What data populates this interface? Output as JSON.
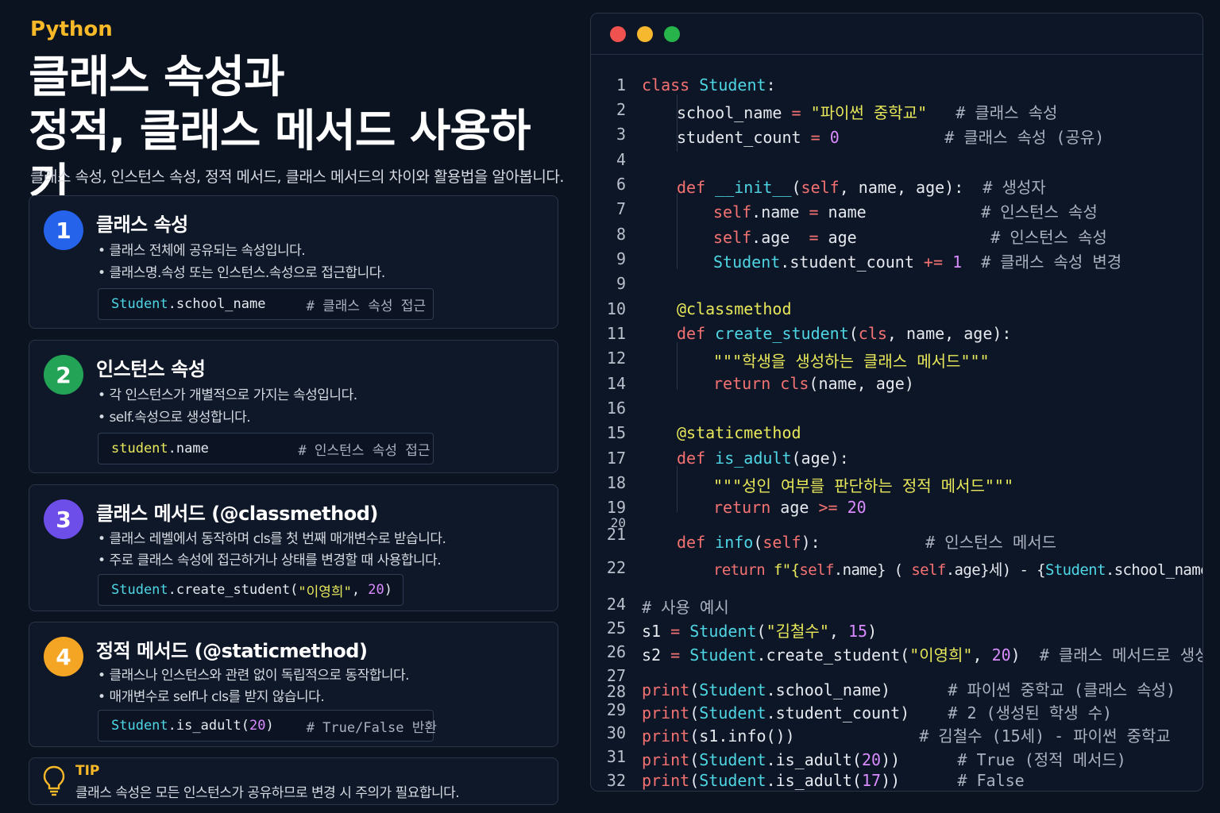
{
  "header": {
    "lang": "Python",
    "title_line1": "클래스 속성과",
    "title_line2": "정적, 클래스 메서드 사용하기",
    "subtitle": "클래스 속성, 인스턴스 속성, 정적 메서드, 클래스 메서드의 차이와 활용법을 알아봅니다."
  },
  "colors": {
    "badge1": "#2563eb",
    "badge2": "#22a355",
    "badge3": "#6d4ee8",
    "badge4": "#f5a524",
    "accent": "#f7b928"
  },
  "cards": [
    {
      "number": "1",
      "title": "클래스 속성",
      "bullets": [
        "클래스 전체에 공유되는 속성입니다.",
        "클래스명.속성 또는 인스턴스.속성으로 접근합니다."
      ],
      "code": {
        "obj": "Student",
        "rest": ".school_name",
        "comment": "# 클래스 속성 접근"
      }
    },
    {
      "number": "2",
      "title": "인스턴스 속성",
      "bullets": [
        "각 인스턴스가 개별적으로 가지는 속성입니다.",
        "self.속성으로 생성합니다."
      ],
      "code": {
        "obj": "student",
        "rest": ".name",
        "comment": "# 인스턴스 속성 접근"
      }
    },
    {
      "number": "3",
      "title": "클래스 메서드 (@classmethod)",
      "bullets": [
        "클래스 레벨에서 동작하며 cls를 첫 번째 매개변수로 받습니다.",
        "주로 클래스 속성에 접근하거나 상태를 변경할 때 사용합니다."
      ],
      "code": {
        "obj": "Student",
        "rest": ".create_student(",
        "str": "\"이영희\"",
        "sep": ", ",
        "num": "20",
        "end": ")"
      }
    },
    {
      "number": "4",
      "title": "정적 메서드 (@staticmethod)",
      "bullets": [
        "클래스나 인스턴스와 관련 없이 독립적으로 동작합니다.",
        "매개변수로 self나 cls를 받지 않습니다."
      ],
      "code": {
        "obj": "Student",
        "rest": ".is_adult(",
        "num": "20",
        "end": ")",
        "comment": "# True/False 반환"
      }
    }
  ],
  "tip": {
    "title": "TIP",
    "text": "클래스 속성은 모든 인스턴스가 공유하므로 변경 시 주의가 필요합니다.",
    "icon": "lightbulb-icon"
  },
  "editor": {
    "line_numbers": [
      "1",
      "2",
      "3",
      "4",
      "6",
      "7",
      "8",
      "9",
      "9",
      "10",
      "11",
      "12",
      "14",
      "16",
      "15",
      "17",
      "18",
      "19",
      "20",
      "21",
      "22",
      "24",
      "25",
      "26",
      "27",
      "28",
      "29",
      "30",
      "31",
      "32"
    ],
    "code": {
      "l1a": "class",
      "l1b": "Student",
      "l1c": ":",
      "l2a": "school_name",
      "l2b": "=",
      "l2c": "\"파이썬 중학교\"",
      "l2d": "# 클래스 속성",
      "l3a": "student_count",
      "l3b": "=",
      "l3c": "0",
      "l3d": "# 클래스 속성 (공유)",
      "l6a": "def",
      "l6b": "__init__",
      "l6c": "(",
      "l6d": "self",
      "l6e": ", name, age):",
      "l6f": "# 생성자",
      "l7a": "self",
      "l7b": ".name",
      "l7c": "=",
      "l7d": "name",
      "l7e": "# 인스턴스 속성",
      "l8a": "self",
      "l8b": ".age",
      "l8c": "=",
      "l8d": "age",
      "l8e": "# 인스턴스 속성",
      "l9a": "Student",
      "l9b": ".student_count",
      "l9c": "+=",
      "l9d": "1",
      "l9e": "# 클래스 속성 변경",
      "l10": "@classmethod",
      "l11a": "def",
      "l11b": "create_student",
      "l11c": "(",
      "l11d": "cls",
      "l11e": ", name, age):",
      "l12": "\"\"\"학생을 생성하는 클래스 메서드\"\"\"",
      "l14a": "return",
      "l14b": "cls",
      "l14c": "(name, age)",
      "l15": "@staticmethod",
      "l17a": "def",
      "l17b": "is_adult",
      "l17c": "(age):",
      "l18": "\"\"\"성인 여부를 판단하는 정적 메서드\"\"\"",
      "l19a": "return",
      "l19b": "age",
      "l19c": ">=",
      "l19d": "20",
      "l21a": "def",
      "l21b": "info",
      "l21c": "(",
      "l21d": "self",
      "l21e": "):",
      "l21f": "# 인스턴스 메서드",
      "l22a": "return",
      "l22b": "f\"{",
      "l22c": "self",
      "l22d": ".name} (",
      "l22e": "self",
      "l22f": ".age}세) - {",
      "l22g": "Student",
      "l22h": ".school_name}\"",
      "l24": "# 사용 예시",
      "l25a": "s1",
      "l25b": "=",
      "l25c": "Student",
      "l25d": "(",
      "l25e": "\"김철수\"",
      "l25f": ", ",
      "l25g": "15",
      "l25h": ")",
      "l26a": "s2",
      "l26b": "=",
      "l26c": "Student",
      "l26d": ".create_student(",
      "l26e": "\"이영희\"",
      "l26f": ", ",
      "l26g": "20",
      "l26h": ")",
      "l26i": "# 클래스 메서드로 생성",
      "l28a": "print",
      "l28b": "(",
      "l28c": "Student",
      "l28d": ".school_name)",
      "l28e": "# 파이썬 중학교 (클래스 속성)",
      "l29a": "print",
      "l29b": "(",
      "l29c": "Student",
      "l29d": ".student_count)",
      "l29e": "# 2 (생성된 학생 수)",
      "l30a": "print",
      "l30b": "(s1.info())",
      "l30c": "# 김철수 (15세) - 파이썬 중학교",
      "l31a": "print",
      "l31b": "(",
      "l31c": "Student",
      "l31d": ".is_adult(",
      "l31e": "20",
      "l31f": "))",
      "l31g": "# True (정적 메서드)",
      "l32a": "print",
      "l32b": "(",
      "l32c": "Student",
      "l32d": ".is_adult(",
      "l32e": "17",
      "l32f": "))",
      "l32g": "# False"
    }
  }
}
